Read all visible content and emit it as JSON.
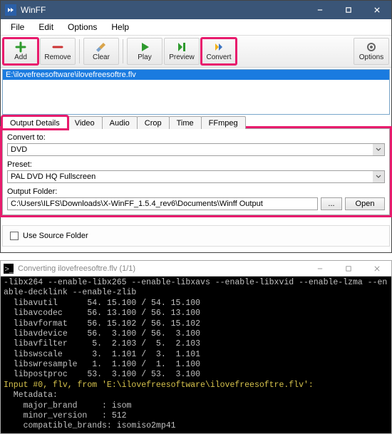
{
  "window": {
    "title": "WinFF"
  },
  "menu": {
    "file": "File",
    "edit": "Edit",
    "options": "Options",
    "help": "Help"
  },
  "toolbar": {
    "add": "Add",
    "remove": "Remove",
    "clear": "Clear",
    "play": "Play",
    "preview": "Preview",
    "convert": "Convert",
    "options": "Options"
  },
  "filelist": {
    "item0": "E:\\ilovefreesoftware\\ilovefreesoftre.flv"
  },
  "tabs": {
    "output": "Output Details",
    "video": "Video",
    "audio": "Audio",
    "crop": "Crop",
    "time": "Time",
    "ffmpeg": "FFmpeg"
  },
  "output": {
    "convert_label": "Convert to:",
    "convert_value": "DVD",
    "preset_label": "Preset:",
    "preset_value": "PAL DVD HQ Fullscreen",
    "folder_label": "Output Folder:",
    "folder_value": "C:\\Users\\ILFS\\Downloads\\X-WinFF_1.5.4_rev6\\Documents\\Winff Output",
    "browse": "...",
    "open": "Open"
  },
  "use_source": "Use Source Folder",
  "console": {
    "title": "Converting ilovefreesoftre.flv (1/1)",
    "lines": [
      "-libx264 --enable-libx265 --enable-libxavs --enable-libxvid --enable-lzma --en",
      "able-decklink --enable-zlib",
      "  libavutil      54. 15.100 / 54. 15.100",
      "  libavcodec     56. 13.100 / 56. 13.100",
      "  libavformat    56. 15.102 / 56. 15.102",
      "  libavdevice    56.  3.100 / 56.  3.100",
      "  libavfilter     5.  2.103 /  5.  2.103",
      "  libswscale      3.  1.101 /  3.  1.101",
      "  libswresample   1.  1.100 /  1.  1.100",
      "  libpostproc    53.  3.100 / 53.  3.100",
      "Input #0, flv, from 'E:\\ilovefreesoftware\\ilovefreesoftre.flv':",
      "  Metadata:",
      "    major_brand     : isom",
      "    minor_version   : 512",
      "    compatible_brands: isomiso2mp41"
    ]
  }
}
